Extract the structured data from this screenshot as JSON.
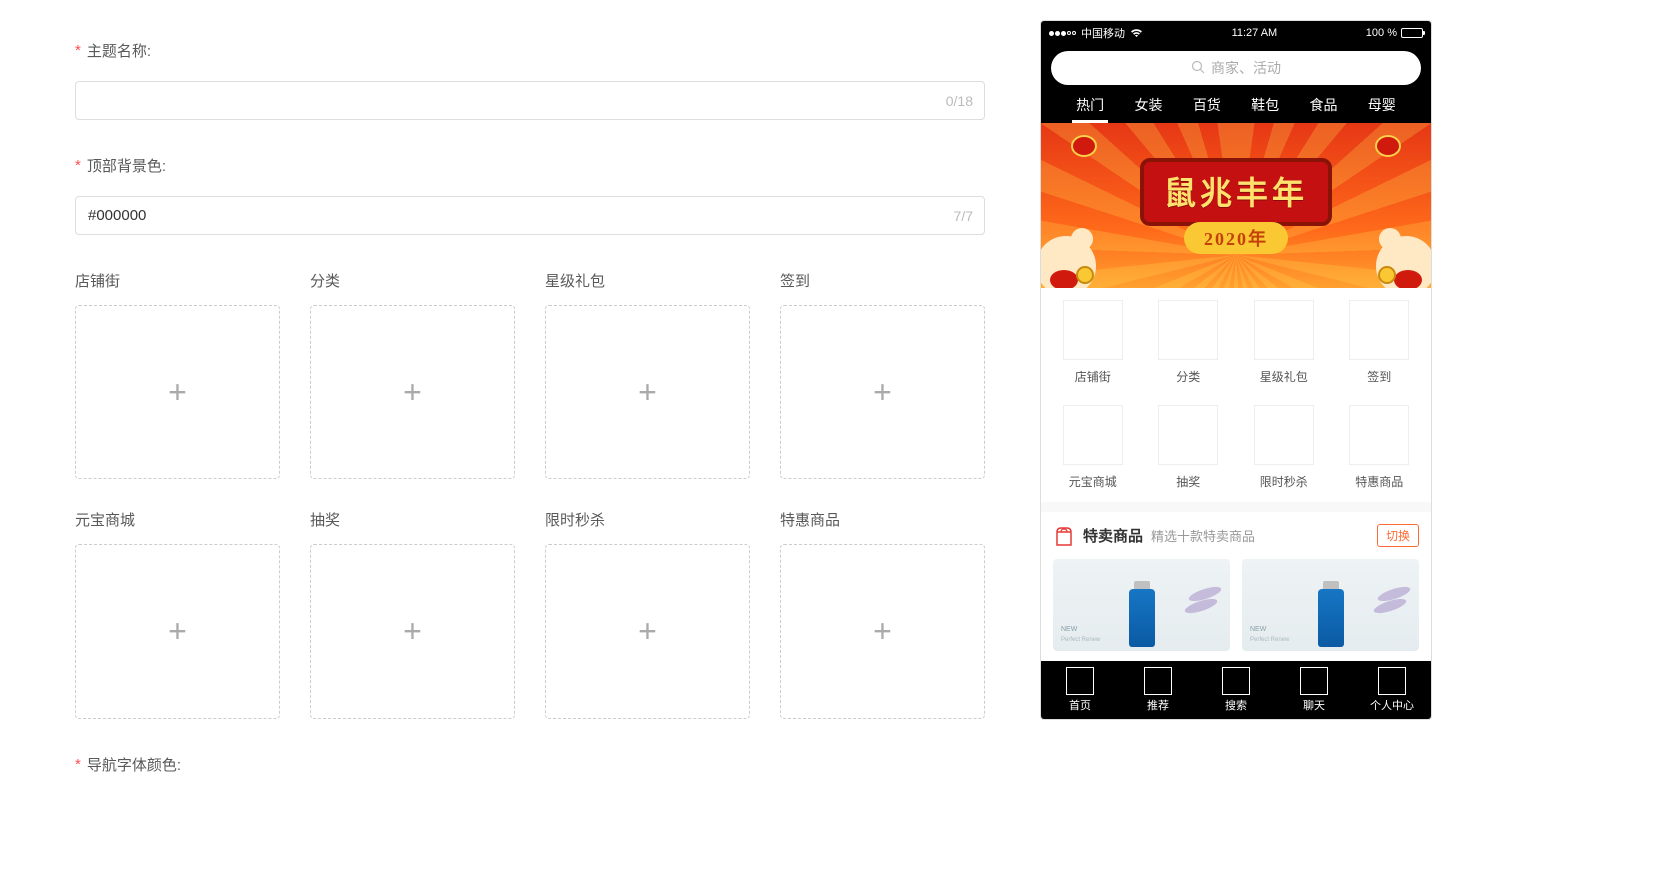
{
  "form": {
    "theme_name": {
      "label": "主题名称:",
      "value": "",
      "counter": "0/18"
    },
    "top_bg_color": {
      "label": "顶部背景色:",
      "value": "#000000",
      "counter": "7/7"
    },
    "nav_font_color": {
      "label": "导航字体颜色:"
    },
    "uploads": [
      {
        "label": "店铺街"
      },
      {
        "label": "分类"
      },
      {
        "label": "星级礼包"
      },
      {
        "label": "签到"
      },
      {
        "label": "元宝商城"
      },
      {
        "label": "抽奖"
      },
      {
        "label": "限时秒杀"
      },
      {
        "label": "特惠商品"
      }
    ]
  },
  "preview": {
    "status_bar": {
      "carrier": "中国移动",
      "time": "11:27 AM",
      "battery_text": "100 %"
    },
    "search_placeholder": "商家、活动",
    "category_tabs": [
      {
        "label": "热门",
        "active": true
      },
      {
        "label": "女装",
        "active": false
      },
      {
        "label": "百货",
        "active": false
      },
      {
        "label": "鞋包",
        "active": false
      },
      {
        "label": "食品",
        "active": false
      },
      {
        "label": "母婴",
        "active": false
      }
    ],
    "banner": {
      "title": "鼠兆丰年",
      "year": "2020年"
    },
    "icons": [
      {
        "label": "店铺街"
      },
      {
        "label": "分类"
      },
      {
        "label": "星级礼包"
      },
      {
        "label": "签到"
      },
      {
        "label": "元宝商城"
      },
      {
        "label": "抽奖"
      },
      {
        "label": "限时秒杀"
      },
      {
        "label": "特惠商品"
      }
    ],
    "featured": {
      "title": "特卖商品",
      "subtitle": "精选十款特卖商品",
      "switch_label": "切换",
      "product_label": "NEW",
      "product_sublabel": "Perfect Renew"
    },
    "bottom_nav": [
      {
        "label": "首页"
      },
      {
        "label": "推荐"
      },
      {
        "label": "搜索"
      },
      {
        "label": "聊天"
      },
      {
        "label": "个人中心"
      }
    ]
  }
}
